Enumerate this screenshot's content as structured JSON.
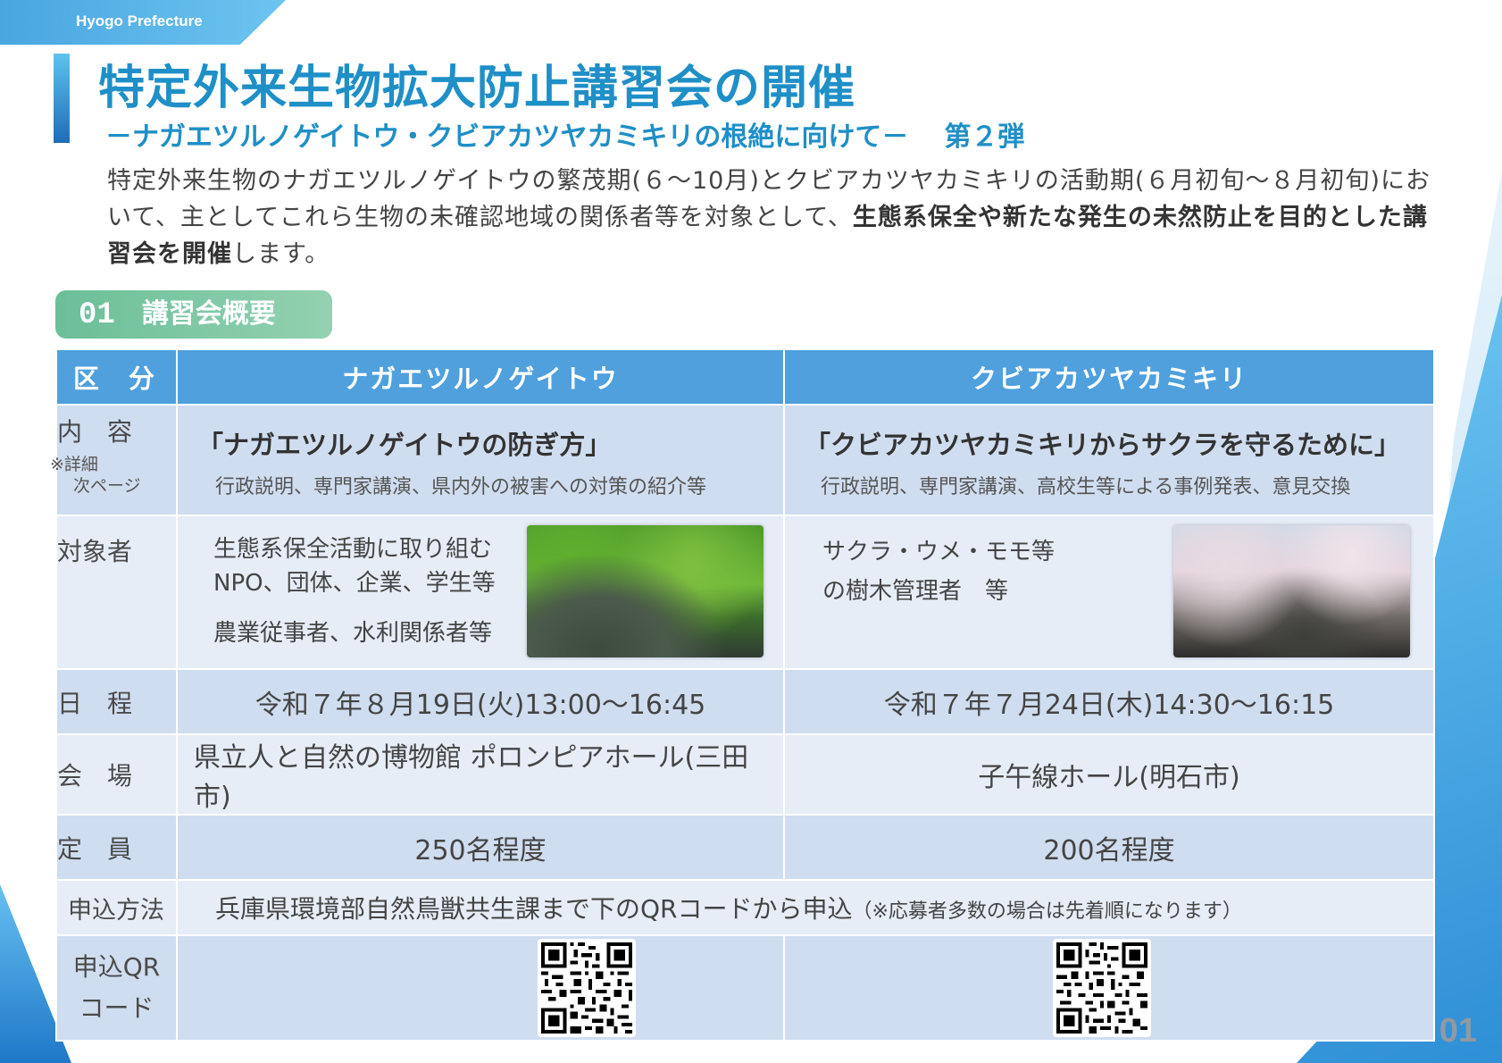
{
  "header": {
    "org_tag": "Hyogo Prefecture",
    "title": "特定外来生物拡大防止講習会の開催",
    "subtitle": "－ナガエツルノゲイトウ・クビアカツヤカミキリの根絶に向けて－",
    "part_tag": "第２弾"
  },
  "intro": {
    "text_1": "特定外来生物のナガエツルノゲイトウの繁茂期(６～10月)とクビアカツヤカミキリの活動期(６月初旬～８月初旬)において、主としてこれら生物の未確認地域の関係者等を対象として、",
    "bold": "生態系保全や新たな発生の未然防止を目的とした講習会を開催",
    "text_2": "します。"
  },
  "section": {
    "number": "01",
    "label": "講習会概要"
  },
  "table": {
    "col_header_label": "区　分",
    "col_a": "ナガエツルノゲイトウ",
    "col_b": "クビアカツヤカミキリ",
    "rows": {
      "content": {
        "label": "内　容",
        "label_note_1": "※詳細",
        "label_note_2": "次ページ",
        "a_title": "「ナガエツルノゲイトウの防ぎ方」",
        "a_desc": "行政説明、専門家講演、県内外の被害への対策の紹介等",
        "b_title": "「クビアカツヤカミキリからサクラを守るために」",
        "b_desc": "行政説明、専門家講演、高校生等による事例発表、意見交換"
      },
      "target": {
        "label": "対象者",
        "a_line_1": "生態系保全活動に取り組む",
        "a_line_2": "NPO、団体、企業、学生等",
        "a_line_3": "農業従事者、水利関係者等",
        "b_line_1": "サクラ・ウメ・モモ等",
        "b_line_2": "の樹木管理者　等"
      },
      "schedule": {
        "label": "日　程",
        "a": "令和７年８月19日(火)13:00～16:45",
        "b": "令和７年７月24日(木)14:30～16:15"
      },
      "venue": {
        "label": "会　場",
        "a": "県立人と自然の博物館 ポロンピアホール(三田市)",
        "b": "子午線ホール(明石市)"
      },
      "capacity": {
        "label": "定　員",
        "a": "250名程度",
        "b": "200名程度"
      },
      "apply": {
        "label": "申込方法",
        "text": "兵庫県環境部自然鳥獣共生課まで下のQRコードから申込",
        "note": "（※応募者多数の場合は先着順になります）"
      },
      "qr": {
        "label_1": "申込QR",
        "label_2": "コード"
      }
    }
  },
  "footer": {
    "page_number": "01"
  },
  "colors": {
    "title_blue": "#1f8fc7",
    "header_blue": "#4fa0dd",
    "row_dark": "#cfddf0",
    "row_light": "#e7edf7",
    "pill_green": "#6bbf98"
  }
}
